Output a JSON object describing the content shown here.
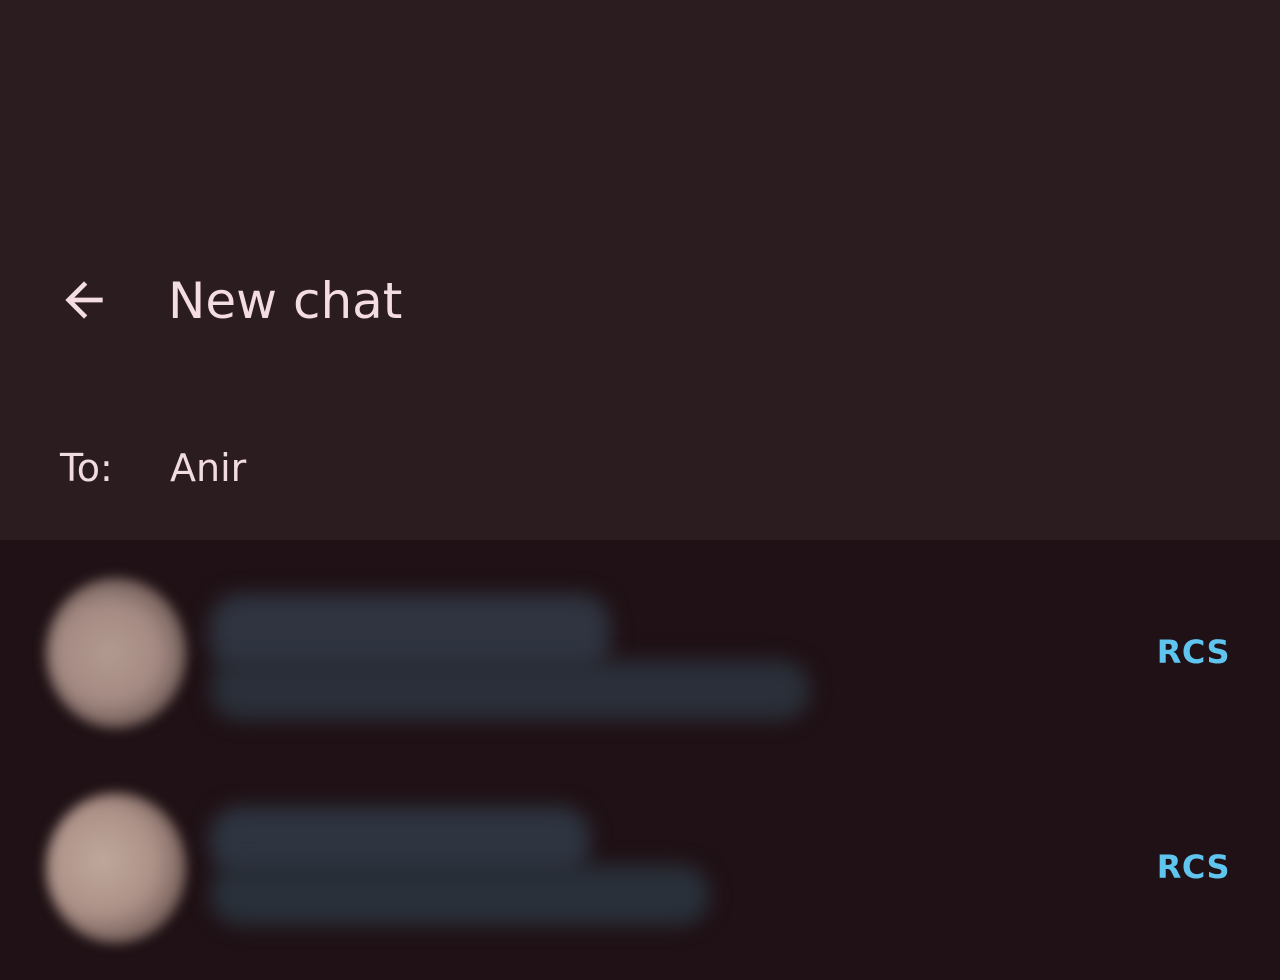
{
  "header": {
    "title": "New chat",
    "back_icon": "arrow-left-icon"
  },
  "recipient": {
    "label": "To:",
    "value": "Anir",
    "placeholder": ""
  },
  "contacts": [
    {
      "badge": "RCS"
    },
    {
      "badge": "RCS"
    }
  ],
  "colors": {
    "header_bg": "#2b1c20",
    "list_bg": "#1f1115",
    "text": "#f3dde2",
    "accent": "#5fc4ee"
  }
}
